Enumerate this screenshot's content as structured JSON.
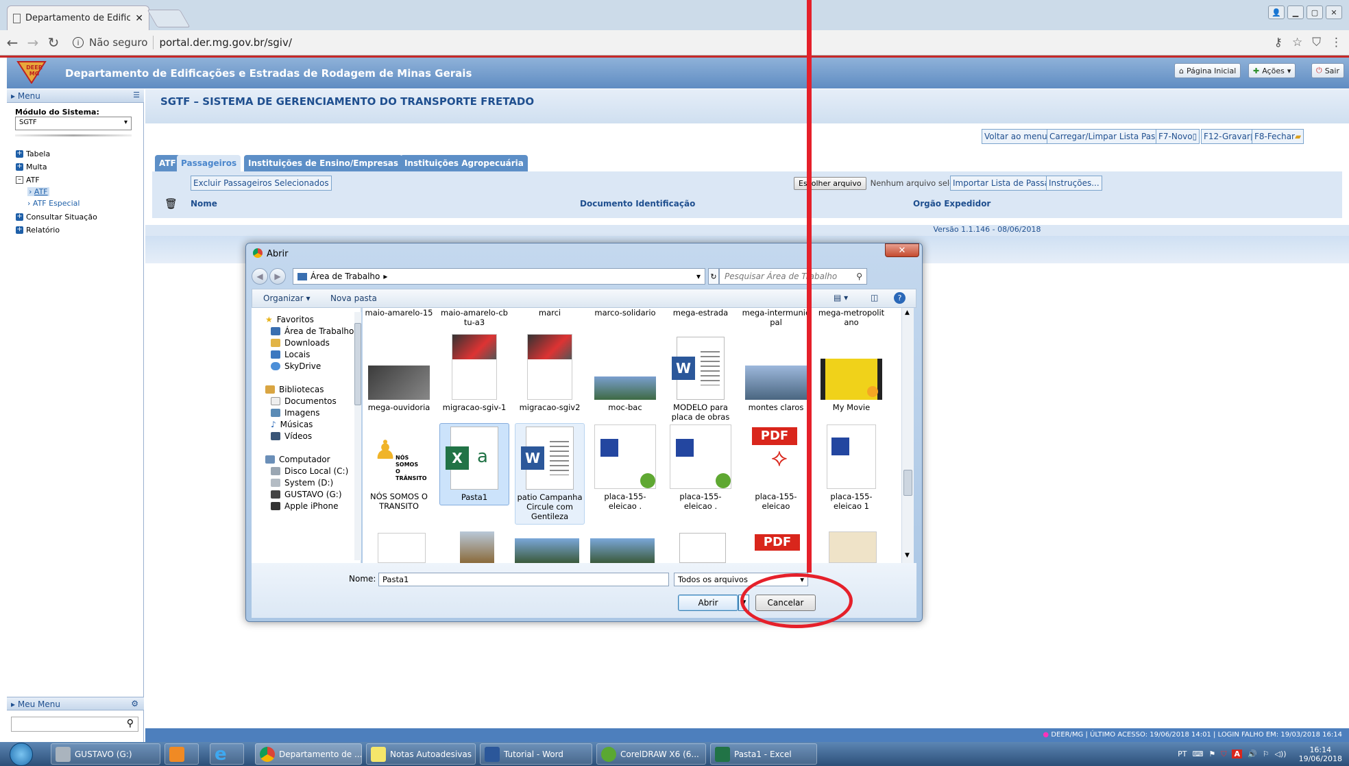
{
  "browser": {
    "tab_title": "Departamento de Edifica",
    "security": "Não seguro",
    "url": "portal.der.mg.gov.br/sgiv/"
  },
  "header": {
    "logo_text": "DEER MG",
    "title": "Departamento de Edificações e Estradas de Rodagem de Minas Gerais",
    "btn_home": "Página Inicial",
    "btn_actions": "Ações",
    "btn_exit": "Sair"
  },
  "sidebar": {
    "menu_label": "Menu",
    "module_label": "Módulo do Sistema:",
    "module_value": "SGTF",
    "tree": [
      "Tabela",
      "Multa",
      "ATF",
      "Consultar Situação",
      "Relatório"
    ],
    "atf_children": [
      "ATF",
      "ATF Especial"
    ],
    "my_menu": "Meu Menu"
  },
  "content": {
    "system_title": "SGTF – SISTEMA DE GERENCIAMENTO DO TRANSPORTE FRETADO",
    "actions": [
      "Voltar ao menu",
      "Carregar/Limpar Lista Passageiro",
      "F7-Novo",
      "F12-Gravar",
      "F8-Fechar"
    ],
    "tabs": [
      "ATF",
      "Passageiros",
      "Instituições de Ensino/Empresas",
      "Instituições Agropecuária"
    ],
    "btn_delete": "Excluir Passageiros Selecionados",
    "file_btn": "Escolher arquivo",
    "no_file": "Nenhum arquivo selecionado",
    "btn_import": "Importar Lista de Passageiros",
    "btn_instructions": "Instruções...",
    "columns": [
      "Nome",
      "Documento Identificação",
      "Orgão Expedidor"
    ],
    "version": "Versão 1.1.146 - 08/06/2018",
    "footer": "DEER/MG   |   ÚLTIMO ACESSO: 19/06/2018 14:01   |   LOGIN FALHO EM: 19/03/2018 16:14"
  },
  "dialog": {
    "title": "Abrir",
    "location": "Área de Trabalho",
    "search_placeholder": "Pesquisar Área de Trabalho",
    "organize": "Organizar",
    "new_folder": "Nova pasta",
    "nav": {
      "favorites": "Favoritos",
      "fav_items": [
        "Área de Trabalho",
        "Downloads",
        "Locais",
        "SkyDrive"
      ],
      "libraries": "Bibliotecas",
      "lib_items": [
        "Documentos",
        "Imagens",
        "Músicas",
        "Vídeos"
      ],
      "computer": "Computador",
      "comp_items": [
        "Disco Local (C:)",
        "System (D:)",
        "GUSTAVO (G:)",
        "Apple iPhone"
      ]
    },
    "row0": [
      "maio-amarelo-15",
      "maio-amarelo-cb tu-a3",
      "marci",
      "marco-solidario",
      "mega-estrada",
      "mega-intermunic pal",
      "mega-metropolit ano"
    ],
    "row1": [
      "mega-ouvidoria",
      "migracao-sgiv-1",
      "migracao-sgiv2",
      "moc-bac",
      "MODELO para placa de obras",
      "montes claros",
      "My Movie"
    ],
    "row2": [
      "NÓS SOMOS O TRANSITO",
      "Pasta1",
      "patio Campanha Circule com Gentileza",
      "placa-155-eleicao .",
      "placa-155-eleicao .",
      "placa-155-eleicao",
      "placa-155-eleicao 1"
    ],
    "nos_somos_badge": "NÓS SOMOS O TRÂNSITO",
    "pdf_label": "PDF",
    "name_label": "Nome:",
    "name_value": "Pasta1",
    "type_value": "Todos os arquivos",
    "open": "Abrir",
    "cancel": "Cancelar"
  },
  "taskbar": {
    "items": [
      "GUSTAVO (G:)",
      "Departamento de ...",
      "Notas Autoadesivas",
      "Tutorial - Word",
      "CorelDRAW X6 (6...",
      "Pasta1 - Excel"
    ],
    "lang": "PT",
    "time": "16:14",
    "date": "19/06/2018"
  },
  "colors": {
    "accent_blue": "#1f4f8f",
    "header_blue": "#5f8cc2",
    "annotation_red": "#e5202a"
  }
}
